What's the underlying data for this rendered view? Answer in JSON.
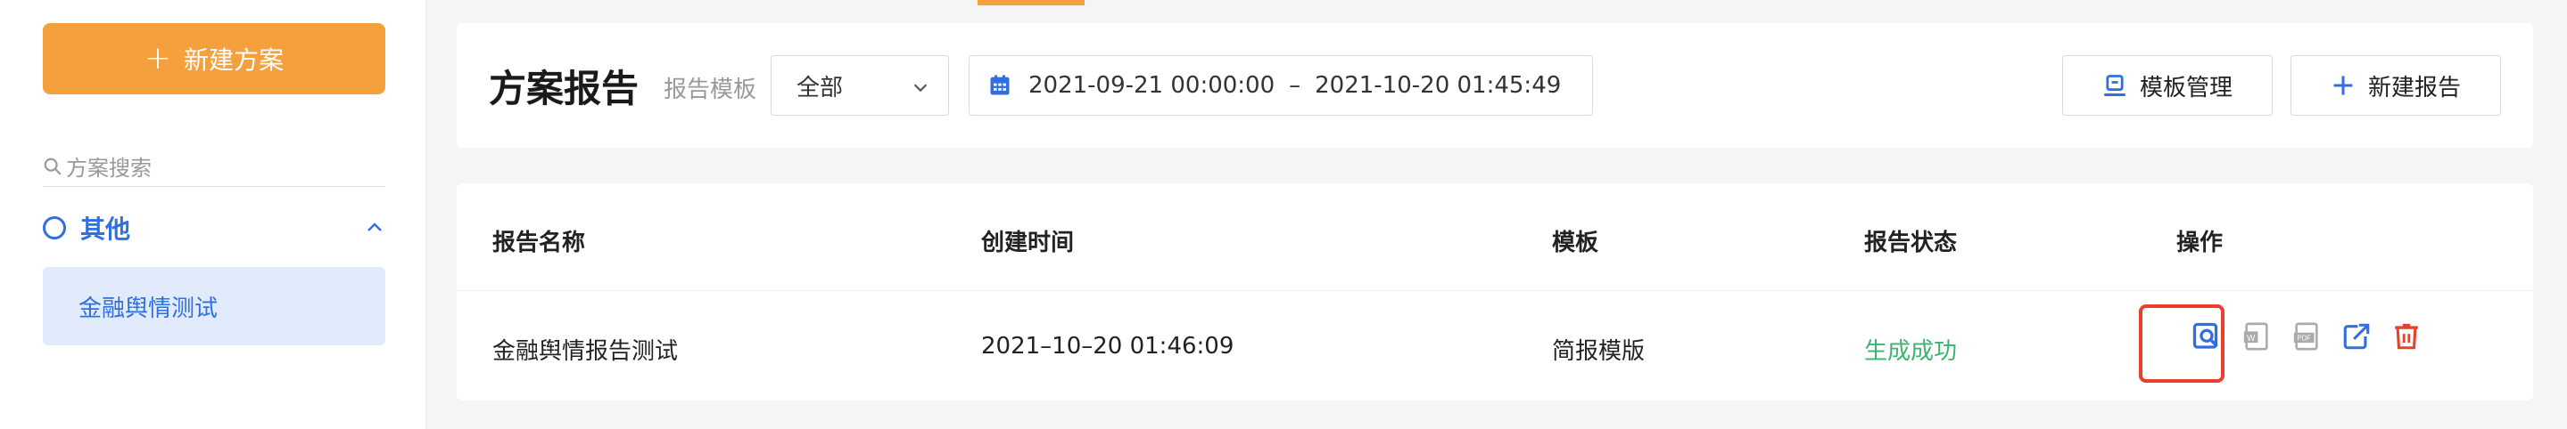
{
  "sidebar": {
    "new_plan_label": "新建方案",
    "search_placeholder": "方案搜索",
    "group_label": "其他",
    "items": [
      {
        "label": "金融舆情测试"
      }
    ]
  },
  "header": {
    "title": "方案报告",
    "template_label": "报告模板",
    "template_select_value": "全部",
    "date_start": "2021-09-21 00:00:00",
    "date_separator": "–",
    "date_end": "2021-10-20 01:45:49",
    "template_manage_label": "模板管理",
    "new_report_label": "新建报告"
  },
  "table": {
    "columns": [
      "报告名称",
      "创建时间",
      "模板",
      "报告状态",
      "操作"
    ],
    "rows": [
      {
        "name": "金融舆情报告测试",
        "created": "2021–10–20 01:46:09",
        "template": "简报模版",
        "status": "生成成功"
      }
    ],
    "actions": [
      "preview-icon",
      "word-icon",
      "pdf-icon",
      "share-icon",
      "delete-icon"
    ]
  },
  "colors": {
    "accent_orange": "#f4a03c",
    "primary_blue": "#2f6fe0",
    "success_green": "#3cb371",
    "danger_red": "#e8402c"
  }
}
